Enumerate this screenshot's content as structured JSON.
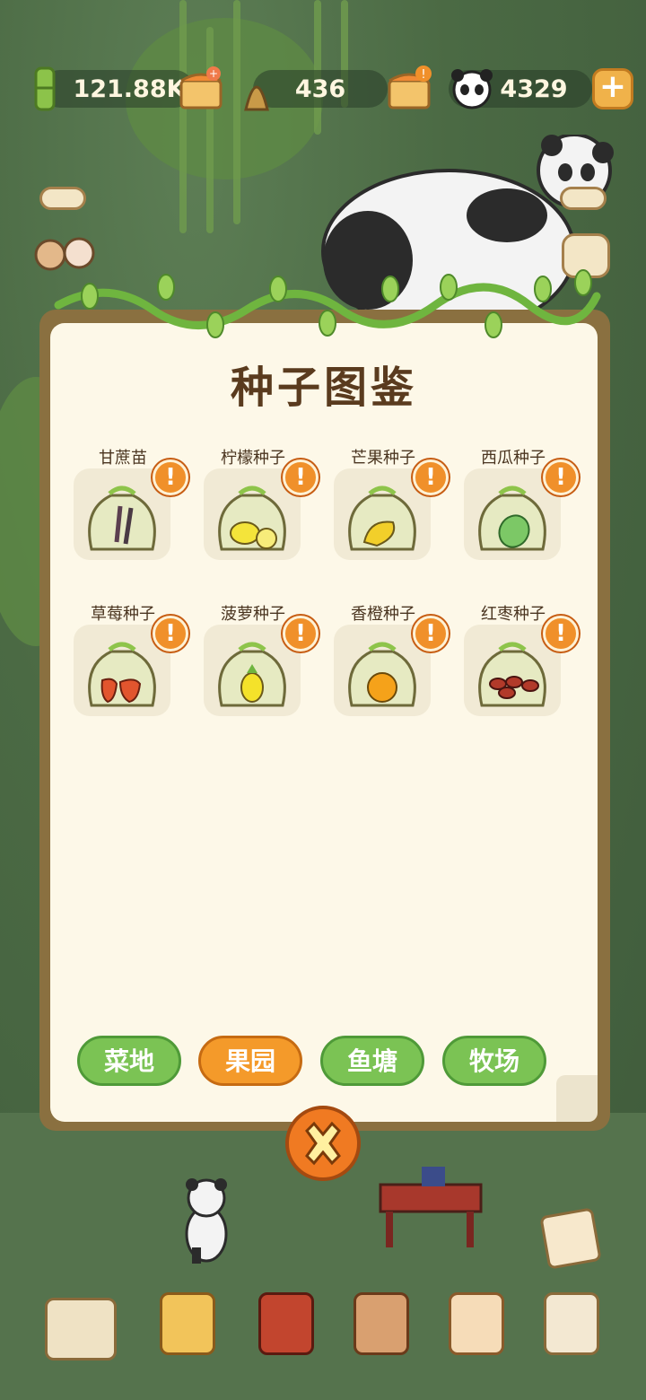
{
  "resources": {
    "bamboo": "121.88K",
    "shoots": "436",
    "pandas": "4329"
  },
  "modal": {
    "title": "种子图鉴",
    "seeds": [
      {
        "label": "甘蔗苗",
        "icon": "sugarcane-seed-icon"
      },
      {
        "label": "柠檬种子",
        "icon": "lemon-seed-icon"
      },
      {
        "label": "芒果种子",
        "icon": "mango-seed-icon"
      },
      {
        "label": "西瓜种子",
        "icon": "watermelon-seed-icon"
      },
      {
        "label": "草莓种子",
        "icon": "strawberry-seed-icon"
      },
      {
        "label": "菠萝种子",
        "icon": "pineapple-seed-icon"
      },
      {
        "label": "香橙种子",
        "icon": "orange-seed-icon"
      },
      {
        "label": "红枣种子",
        "icon": "red-date-seed-icon"
      }
    ],
    "alert_mark": "!",
    "tabs": [
      {
        "label": "菜地",
        "active": false
      },
      {
        "label": "果园",
        "active": true
      },
      {
        "label": "鱼塘",
        "active": false
      },
      {
        "label": "牧场",
        "active": false
      }
    ]
  },
  "colors": {
    "accent_orange": "#f49a2a",
    "tab_green": "#7bc354",
    "panel_bg": "#fdf8e8",
    "title_brown": "#5a3b1e"
  }
}
